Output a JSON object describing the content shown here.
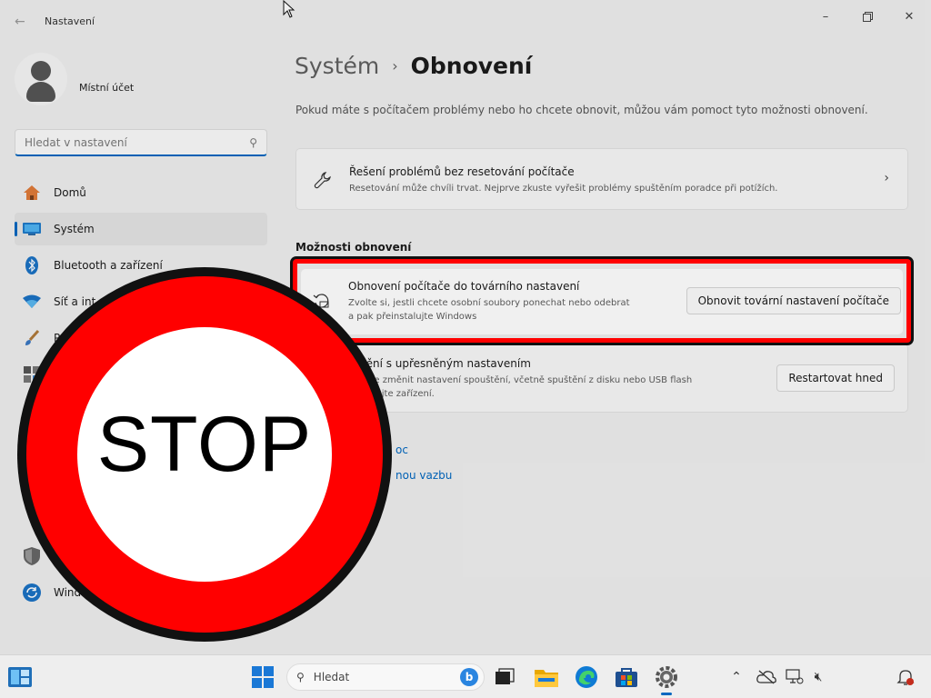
{
  "window": {
    "title": "Nastavení"
  },
  "sidebar": {
    "account_name": "Místní účet",
    "search_placeholder": "Hledat v nastavení",
    "items": [
      {
        "label": "Domů",
        "icon": "home-icon"
      },
      {
        "label": "Systém",
        "icon": "system-icon",
        "active": true
      },
      {
        "label": "Bluetooth a zařízení",
        "icon": "bluetooth-icon"
      },
      {
        "label": "Síť a int",
        "icon": "wifi-icon"
      },
      {
        "label": "P",
        "icon": "brush-icon"
      },
      {
        "label": "",
        "icon": "apps-icon"
      },
      {
        "label": "",
        "icon": "accounts-icon"
      },
      {
        "label": "",
        "icon": "time-icon"
      },
      {
        "label": "",
        "icon": "gaming-icon"
      },
      {
        "label": "",
        "icon": "accessibility-icon"
      },
      {
        "label": "",
        "icon": "privacy-icon"
      },
      {
        "label": "Wind",
        "icon": "update-icon"
      }
    ]
  },
  "main": {
    "breadcrumb_parent": "Systém",
    "breadcrumb_sep": "›",
    "breadcrumb_current": "Obnovení",
    "intro": "Pokud máte s počítačem problémy nebo ho chcete obnovit, můžou vám pomoct tyto možnosti obnovení.",
    "troubleshoot": {
      "title": "Řešení problémů bez resetování počítače",
      "desc": "Resetování může chvíli trvat. Nejprve zkuste vyřešit problémy spuštěním poradce při potížích."
    },
    "section_label": "Možnosti obnovení",
    "reset": {
      "title": "Obnovení počítače do továrního nastavení",
      "desc_line1": "Zvolte si, jestli chcete osobní soubory ponechat nebo odebrat",
      "desc_line2": "a pak přeinstalujte Windows",
      "button": "Obnovit tovární nastavení počítače"
    },
    "advanced": {
      "title": "pštění s upřesněným nastavením",
      "desc_line1": "chcete změnit nastavení spouštění, včetně spuštění z disku nebo USB flash",
      "desc_line2": "estartujte zařízení.",
      "button": "Restartovat hned"
    },
    "links": [
      "oc",
      "nou vazbu"
    ]
  },
  "overlay": {
    "stop_text": "STOP",
    "ring_color": "#ff0000"
  },
  "taskbar": {
    "search_label": "Hledat"
  },
  "colors": {
    "accent": "#0067c0",
    "highlight": "#ff0000"
  }
}
